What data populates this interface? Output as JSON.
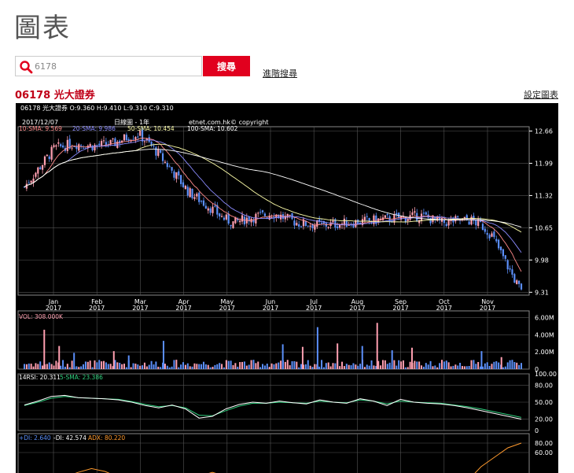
{
  "page": {
    "title": "圖表"
  },
  "search": {
    "value": "6178",
    "button_label": "搜尋",
    "advanced_label": "進階搜尋"
  },
  "stock": {
    "title": "06178 光大證券",
    "settings_label": "設定圖表"
  },
  "chart_info": {
    "ohlc": "06178 光大證券 O:9.360 H:9.410 L:9.310 C:9.310",
    "date": "2017/12/07",
    "period": "日線圖 - 1年",
    "copyright": "etnet.com.hk© copyright",
    "sma10_label": "10-SMA: 9.569",
    "sma20_label": "20-SMA: 9.986",
    "sma50_label": "50-SMA: 10.454",
    "sma100_label": "100-SMA: 10.602",
    "vol_label": "VOL: 308.000K",
    "rsi_label": "14RSI: 20.311",
    "rsi_sma_label": "5-SMA: 23.386",
    "di_plus_label": "+DI: 2.640",
    "di_minus_label": "-DI: 42.574",
    "adx_label": "ADX: 80.220"
  },
  "colors": {
    "up": "#ff9fb0",
    "down": "#5b8ff9",
    "sma10": "#ff8a8a",
    "sma20": "#8b8bff",
    "sma50": "#ffffaa",
    "sma100": "#ffffff",
    "rsi": "#ffffff",
    "rsi_sma": "#2fd07e",
    "adx": "#ff9a2e",
    "grid": "#555555"
  },
  "chart_data": {
    "type": "candlestick",
    "x_tick_labels": [
      {
        "month": "Jan",
        "year": "2017"
      },
      {
        "month": "Feb",
        "year": "2017"
      },
      {
        "month": "Mar",
        "year": "2017"
      },
      {
        "month": "Apr",
        "year": "2017"
      },
      {
        "month": "May",
        "year": "2017"
      },
      {
        "month": "Jun",
        "year": "2017"
      },
      {
        "month": "Jul",
        "year": "2017"
      },
      {
        "month": "Aug",
        "year": "2017"
      },
      {
        "month": "Sep",
        "year": "2017"
      },
      {
        "month": "Oct",
        "year": "2017"
      },
      {
        "month": "Nov",
        "year": "2017"
      }
    ],
    "price_ticks": [
      "12.66",
      "11.99",
      "11.32",
      "10.65",
      "9.98",
      "9.31"
    ],
    "price_range": [
      9.25,
      12.75
    ],
    "volume_ticks": [
      "6.00M",
      "4.00M",
      "2.00M",
      "0"
    ],
    "volume_range": [
      0,
      6.8
    ],
    "rsi_ticks": [
      "100.00",
      "80.00",
      "50.00",
      "20.00",
      "0"
    ],
    "rsi_range": [
      0,
      100
    ],
    "adx_ticks": [
      "80.00",
      "60.00"
    ],
    "price_path": {
      "x": [
        0,
        0.03,
        0.06,
        0.1,
        0.14,
        0.18,
        0.21,
        0.23,
        0.26,
        0.3,
        0.33,
        0.37,
        0.4,
        0.42,
        0.45,
        0.5,
        0.55,
        0.6,
        0.65,
        0.7,
        0.75,
        0.8,
        0.84,
        0.87,
        0.9,
        0.92,
        0.94,
        0.96,
        0.98,
        1.0
      ],
      "y": [
        11.5,
        11.9,
        12.3,
        12.4,
        12.35,
        12.4,
        12.55,
        12.6,
        12.3,
        11.8,
        11.4,
        11.1,
        10.85,
        10.75,
        10.85,
        10.95,
        10.75,
        10.7,
        10.75,
        10.8,
        10.85,
        10.9,
        10.75,
        10.8,
        10.8,
        10.7,
        10.5,
        10.1,
        9.7,
        9.31
      ]
    },
    "volume_spikes": [
      {
        "x": 0.04,
        "v": 4.6,
        "up": true
      },
      {
        "x": 0.07,
        "v": 2.7,
        "up": true
      },
      {
        "x": 0.1,
        "v": 1.9,
        "up": false
      },
      {
        "x": 0.18,
        "v": 2.1,
        "up": true
      },
      {
        "x": 0.21,
        "v": 1.6,
        "up": false
      },
      {
        "x": 0.28,
        "v": 3.3,
        "up": false
      },
      {
        "x": 0.52,
        "v": 2.9,
        "up": false
      },
      {
        "x": 0.56,
        "v": 2.6,
        "up": true
      },
      {
        "x": 0.59,
        "v": 4.9,
        "up": false
      },
      {
        "x": 0.63,
        "v": 3.0,
        "up": true
      },
      {
        "x": 0.68,
        "v": 2.7,
        "up": false
      },
      {
        "x": 0.71,
        "v": 5.4,
        "up": true
      },
      {
        "x": 0.74,
        "v": 2.2,
        "up": false
      },
      {
        "x": 0.78,
        "v": 2.5,
        "up": true
      },
      {
        "x": 0.92,
        "v": 2.1,
        "up": false
      },
      {
        "x": 0.96,
        "v": 1.4,
        "up": true
      }
    ],
    "rsi_series": [
      45,
      52,
      60,
      62,
      58,
      57,
      56,
      54,
      50,
      44,
      40,
      45,
      38,
      22,
      25,
      38,
      46,
      50,
      48,
      52,
      49,
      47,
      54,
      50,
      48,
      56,
      52,
      44,
      55,
      50,
      48,
      47,
      44,
      40,
      35,
      30,
      25,
      20
    ],
    "rsi_sma_series": [
      44,
      50,
      57,
      60,
      58,
      57,
      56,
      55,
      51,
      46,
      42,
      44,
      40,
      27,
      26,
      35,
      43,
      48,
      48,
      50,
      49,
      48,
      52,
      50,
      49,
      54,
      52,
      47,
      52,
      50,
      49,
      48,
      45,
      42,
      38,
      33,
      28,
      23
    ],
    "adx_series": [
      0,
      0,
      2,
      8,
      18,
      26,
      20,
      8,
      2,
      0,
      0,
      0,
      0,
      10,
      18,
      10,
      0,
      0,
      0,
      0,
      0,
      0,
      0,
      0,
      0,
      0,
      0,
      0,
      0,
      0,
      0,
      0,
      0,
      0,
      30,
      50,
      70,
      80
    ]
  }
}
